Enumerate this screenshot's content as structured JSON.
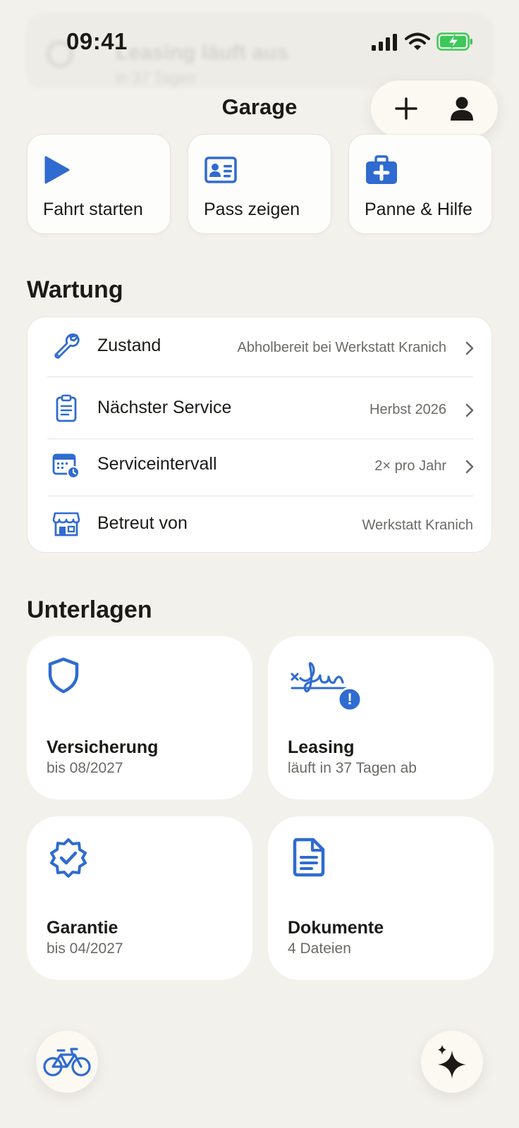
{
  "status_bar": {
    "time": "09:41"
  },
  "ghost_notification": {
    "title": "Leasing läuft aus",
    "subtitle": "in 37 Tagen"
  },
  "header": {
    "title": "Garage",
    "add_icon": "plus-icon",
    "profile_icon": "person-icon"
  },
  "quick_actions": [
    {
      "label": "Fahrt starten",
      "icon": "play-icon"
    },
    {
      "label": "Pass zeigen",
      "icon": "id-card-icon"
    },
    {
      "label": "Panne & Hilfe",
      "icon": "first-aid-kit-icon"
    }
  ],
  "maintenance": {
    "title": "Wartung",
    "rows": [
      {
        "label": "Zustand",
        "value": "Abholbereit bei Werkstatt Kranich",
        "icon": "wrench-icon"
      },
      {
        "label": "Nächster Service",
        "value": "Herbst 2026",
        "icon": "clipboard-icon"
      },
      {
        "label": "Serviceintervall",
        "value": "2× pro Jahr",
        "icon": "calendar-clock-icon"
      },
      {
        "label": "Betreut von",
        "value": "Werkstatt Kranich",
        "icon": "storefront-icon"
      }
    ]
  },
  "documents": {
    "title": "Unterlagen",
    "tiles": [
      {
        "title": "Versicherung",
        "subtitle": "bis 08/2027",
        "icon": "shield-icon"
      },
      {
        "title": "Leasing",
        "subtitle": "läuft in 37 Tagen ab",
        "icon": "signature-icon",
        "badge": "!"
      },
      {
        "title": "Garantie",
        "subtitle": "bis 04/2027",
        "icon": "verified-badge-icon"
      },
      {
        "title": "Dokumente",
        "subtitle": "4 Dateien",
        "icon": "document-icon"
      }
    ]
  },
  "bottom": {
    "left_icon": "bicycle-icon",
    "right_icon": "sparkles-icon"
  },
  "colors": {
    "accent": "#2f6bd0",
    "background": "#f2f1ec",
    "battery_green": "#3cc95a"
  }
}
